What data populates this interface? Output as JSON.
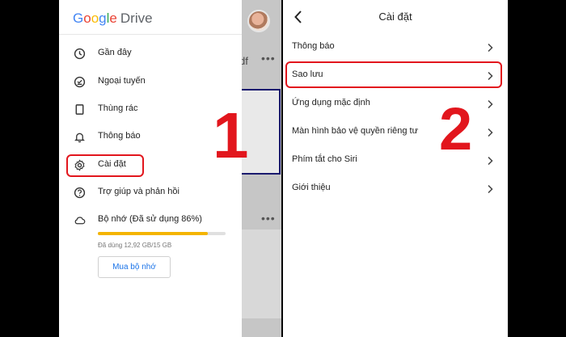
{
  "left": {
    "logo": {
      "google": "Google",
      "drive": "Drive"
    },
    "background": {
      "title_fragment": "df",
      "more_dots": "•••"
    },
    "menu": [
      {
        "label": "Gần đây",
        "icon": "clock-icon"
      },
      {
        "label": "Ngoại tuyến",
        "icon": "offline-check-icon"
      },
      {
        "label": "Thùng rác",
        "icon": "trash-icon"
      },
      {
        "label": "Thông báo",
        "icon": "bell-icon"
      },
      {
        "label": "Cài đặt",
        "icon": "gear-icon"
      },
      {
        "label": "Trợ giúp và phản hồi",
        "icon": "help-icon"
      },
      {
        "label": "Bộ nhớ (Đã sử dụng 86%)",
        "icon": "cloud-icon"
      }
    ],
    "storage": {
      "used_fraction": 0.86,
      "detail": "Đã dùng 12,92 GB/15 GB",
      "bar_color": "#f4b400"
    },
    "buy_button": "Mua bộ nhớ",
    "step_number": "1"
  },
  "right": {
    "title": "Cài đặt",
    "rows": [
      {
        "label": "Thông báo"
      },
      {
        "label": "Sao lưu"
      },
      {
        "label": "Ứng dụng mặc định"
      },
      {
        "label": "Màn hình bảo vệ quyền riêng tư"
      },
      {
        "label": "Phím tắt cho Siri"
      },
      {
        "label": "Giới thiệu"
      }
    ],
    "step_number": "2"
  },
  "colors": {
    "callout": "#e2161d",
    "accent": "#1a73e8"
  }
}
